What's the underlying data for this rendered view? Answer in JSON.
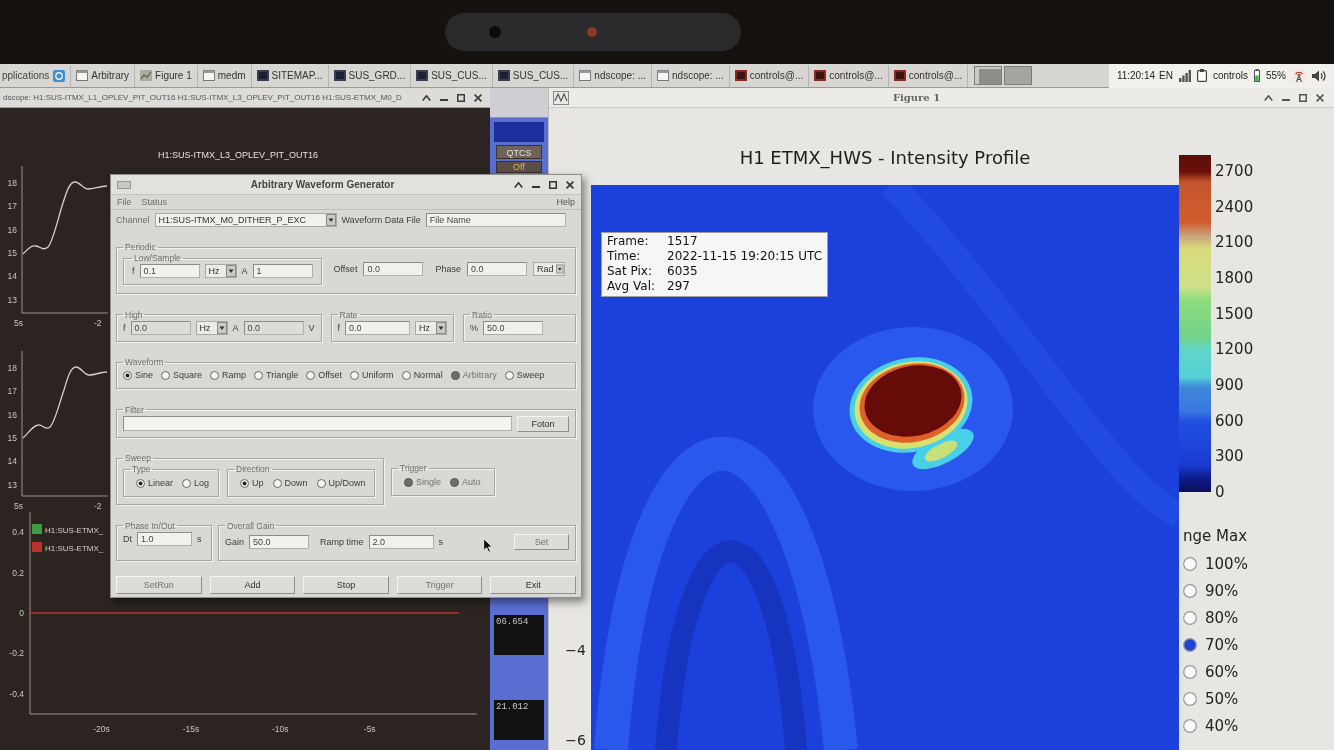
{
  "taskbar": {
    "apps_menu": "pplications",
    "tasks": [
      {
        "label": "Arbitrary",
        "kind": "window",
        "selected": false
      },
      {
        "label": "Figure 1",
        "kind": "figure",
        "selected": false
      },
      {
        "label": "medm",
        "kind": "window",
        "selected": false
      },
      {
        "label": "SITEMAP...",
        "kind": "screen",
        "selected": false
      },
      {
        "label": "SUS_GRD...",
        "kind": "screen",
        "selected": false
      },
      {
        "label": "SUS_CUS...",
        "kind": "screen",
        "selected": false
      },
      {
        "label": "SUS_CUS...",
        "kind": "screen",
        "selected": false
      },
      {
        "label": "ndscope: ...",
        "kind": "window",
        "selected": false
      },
      {
        "label": "ndscope: ...",
        "kind": "window",
        "selected": false
      },
      {
        "label": "controls@...",
        "kind": "terminal",
        "selected": false
      },
      {
        "label": "controls@...",
        "kind": "terminal",
        "selected": false
      },
      {
        "label": "controls@...",
        "kind": "terminal",
        "selected": false
      }
    ],
    "clock": "11:20:14",
    "keyboard_layout": "EN",
    "user": "controls",
    "battery": "55%"
  },
  "ndscope": {
    "title": "dscope: H1:SUS-ITMX_L1_OPLEV_PIT_OUT16 H1:SUS-ITMX_L3_OPLEV_PIT_OUT16 H1:SUS-ETMX_M0_D",
    "plots": [
      {
        "title": "H1:SUS-ITMX_L3_OPLEV_PIT_OUT16",
        "y_ticks": [
          "18",
          "17",
          "16",
          "15",
          "14",
          "13"
        ],
        "x_ticks": [
          "5s",
          "-2"
        ]
      },
      {
        "y_ticks": [
          "18",
          "17",
          "16",
          "15",
          "14",
          "13"
        ],
        "x_ticks": [
          "5s",
          "-2"
        ]
      },
      {
        "chart_data": {
          "type": "line",
          "x": [
            -24,
            0
          ],
          "series": [
            {
              "name": "H1:SUS-ETMX_",
              "color": "#3e9a44",
              "values": [
                null,
                null
              ]
            },
            {
              "name": "H1:SUS-ETMX_",
              "color": "#b8322a",
              "values": [
                0,
                0
              ]
            }
          ],
          "xlim": [
            -24,
            1
          ],
          "ylim": [
            -0.5,
            0.5
          ],
          "xticks": [
            {
              "value": -20,
              "label": "-20s"
            },
            {
              "value": -15,
              "label": "-15s"
            },
            {
              "value": -10,
              "label": "-10s"
            },
            {
              "value": -5,
              "label": "-5s"
            }
          ],
          "yticks": [
            0.4,
            0.2,
            0,
            -0.2,
            -0.4
          ]
        }
      }
    ]
  },
  "medm": {
    "buttons": [
      "QTCS",
      "Off"
    ],
    "readouts": [
      "06.654",
      "21.012"
    ]
  },
  "figure": {
    "title": "Figure 1",
    "plot_title": "H1 ETMX_HWS - Intensity Profile",
    "y_ticks": [
      "−4",
      "−6"
    ],
    "info": [
      {
        "label": "Frame:",
        "value": "1517"
      },
      {
        "label": "Time:",
        "value": "2022-11-15 19:20:15 UTC"
      },
      {
        "label": "Sat Pix:",
        "value": "6035"
      },
      {
        "label": "Avg Val:",
        "value": "297"
      }
    ],
    "colorbar_ticks": [
      "2700",
      "2400",
      "2100",
      "1800",
      "1500",
      "1200",
      "900",
      "600",
      "300",
      "0"
    ],
    "range": {
      "title": "nge Max",
      "options": [
        {
          "label": "100%",
          "selected": false
        },
        {
          "label": "90%",
          "selected": false
        },
        {
          "label": "80%",
          "selected": false
        },
        {
          "label": "70%",
          "selected": true
        },
        {
          "label": "60%",
          "selected": false
        },
        {
          "label": "50%",
          "selected": false
        },
        {
          "label": "40%",
          "selected": false
        }
      ]
    }
  },
  "awg": {
    "title": "Arbitrary Waveform Generator",
    "menu": [
      "File",
      "Status"
    ],
    "help": "Help",
    "channel": {
      "label": "Channel",
      "value": "H1:SUS-ITMX_M0_DITHER_P_EXC"
    },
    "data_file": {
      "label": "Waveform Data File",
      "value": "File Name"
    },
    "periodic": {
      "title": "Periodic",
      "low": {
        "title": "Low/Sample",
        "f_label": "f",
        "f_value": "0.1",
        "f_unit": "Hz",
        "a_label": "A",
        "a_value": "1"
      },
      "offset_label": "Offset",
      "offset_value": "0.0",
      "phase_label": "Phase",
      "phase_value": "0.0",
      "phase_unit": "Rad"
    },
    "high": {
      "title": "High",
      "f_label": "f",
      "f_value": "0.0",
      "f_unit": "Hz",
      "a_label": "A",
      "a_value": "0.0",
      "a_unit": "V"
    },
    "rate": {
      "title": "Rate",
      "f_label": "f",
      "f_value": "0.0",
      "f_unit": "Hz"
    },
    "ratio": {
      "title": "Ratio",
      "label": "%",
      "value": "50.0"
    },
    "waveform": {
      "title": "Waveform",
      "options": [
        {
          "label": "Sine",
          "selected": true,
          "disabled": false
        },
        {
          "label": "Square",
          "selected": false,
          "disabled": false
        },
        {
          "label": "Ramp",
          "selected": false,
          "disabled": false
        },
        {
          "label": "Triangle",
          "selected": false,
          "disabled": false
        },
        {
          "label": "Offset",
          "selected": false,
          "disabled": false
        },
        {
          "label": "Uniform",
          "selected": false,
          "disabled": false
        },
        {
          "label": "Normal",
          "selected": false,
          "disabled": false
        },
        {
          "label": "Arbitrary",
          "selected": false,
          "disabled": true
        },
        {
          "label": "Sweep",
          "selected": false,
          "disabled": false
        }
      ]
    },
    "filter": {
      "title": "Filter",
      "button": "Foton"
    },
    "sweep": {
      "title": "Sweep",
      "type": {
        "title": "Type",
        "options": [
          {
            "label": "Linear",
            "selected": true,
            "disabled": false
          },
          {
            "label": "Log",
            "selected": false,
            "disabled": false
          }
        ]
      },
      "direction": {
        "title": "Direction",
        "options": [
          {
            "label": "Up",
            "selected": true,
            "disabled": false
          },
          {
            "label": "Down",
            "selected": false,
            "disabled": false
          },
          {
            "label": "Up/Down",
            "selected": false,
            "disabled": false
          }
        ]
      }
    },
    "trigger": {
      "title": "Trigger",
      "options": [
        {
          "label": "Single",
          "selected": false,
          "disabled": true
        },
        {
          "label": "Auto",
          "selected": false,
          "disabled": true
        }
      ]
    },
    "phase_io": {
      "title": "Phase In/Out",
      "label": "Dt",
      "value": "1.0",
      "unit": "s"
    },
    "gain": {
      "title": "Overall Gain",
      "gain_label": "Gain",
      "gain_value": "50.0",
      "ramp_label": "Ramp time",
      "ramp_value": "2.0",
      "ramp_unit": "s",
      "set_button": {
        "label": "Set",
        "disabled": true
      }
    },
    "buttons": [
      {
        "label": "SetRun",
        "disabled": true
      },
      {
        "label": "Add",
        "disabled": false
      },
      {
        "label": "Stop",
        "disabled": false
      },
      {
        "label": "Trigger",
        "disabled": true
      },
      {
        "label": "Exit",
        "disabled": false
      }
    ]
  }
}
